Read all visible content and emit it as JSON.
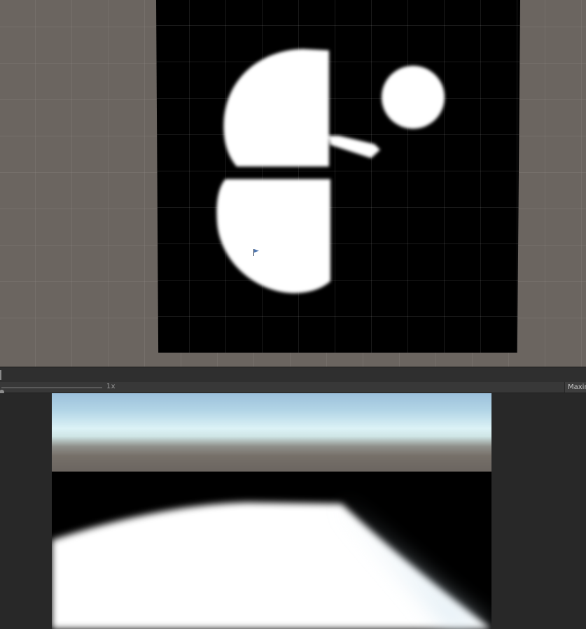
{
  "toolbar": {
    "scale_label": "1x",
    "maximize_label": "Maximize On Play"
  },
  "colors": {
    "editor_background": "#282828",
    "scene_background": "#6b6560",
    "plane": "#000000",
    "shape": "#ffffff",
    "sky_top": "#9cc0db",
    "horizon": "#dcf2f6"
  },
  "icons": {
    "scene_cursor": "flag-cursor-icon"
  }
}
